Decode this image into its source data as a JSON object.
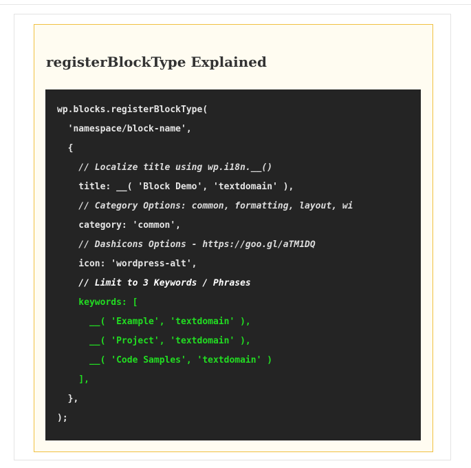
{
  "callout": {
    "title": "registerBlockType Explained"
  },
  "code": {
    "lines": [
      {
        "text": "wp.blocks.registerBlockType(",
        "style": "normal"
      },
      {
        "text": "  'namespace/block-name',",
        "style": "normal"
      },
      {
        "text": "  {",
        "style": "normal"
      },
      {
        "text": "    // Localize title using wp.i18n.__()",
        "style": "comment"
      },
      {
        "text": "    title: __( 'Block Demo', 'textdomain' ),",
        "style": "normal"
      },
      {
        "text": "    // Category Options: common, formatting, layout, wi",
        "style": "comment"
      },
      {
        "text": "    category: 'common',",
        "style": "normal"
      },
      {
        "text": "    // Dashicons Options - https://goo.gl/aTM1DQ",
        "style": "comment"
      },
      {
        "text": "    icon: 'wordpress-alt',",
        "style": "normal"
      },
      {
        "text": "    // Limit to 3 Keywords / Phrases",
        "style": "hl-comment"
      },
      {
        "text": "    keywords: [",
        "style": "highlight"
      },
      {
        "text": "      __( 'Example', 'textdomain' ),",
        "style": "highlight"
      },
      {
        "text": "      __( 'Project', 'textdomain' ),",
        "style": "highlight"
      },
      {
        "text": "      __( 'Code Samples', 'textdomain' )",
        "style": "highlight"
      },
      {
        "text": "    ],",
        "style": "highlight"
      },
      {
        "text": "  },",
        "style": "normal"
      },
      {
        "text": ");",
        "style": "normal"
      }
    ]
  },
  "colors": {
    "callout_border": "#f0c040",
    "callout_background": "#fffcf1",
    "code_background": "#242424",
    "code_text": "#e6e6e6",
    "highlight_text": "#22dd22"
  }
}
